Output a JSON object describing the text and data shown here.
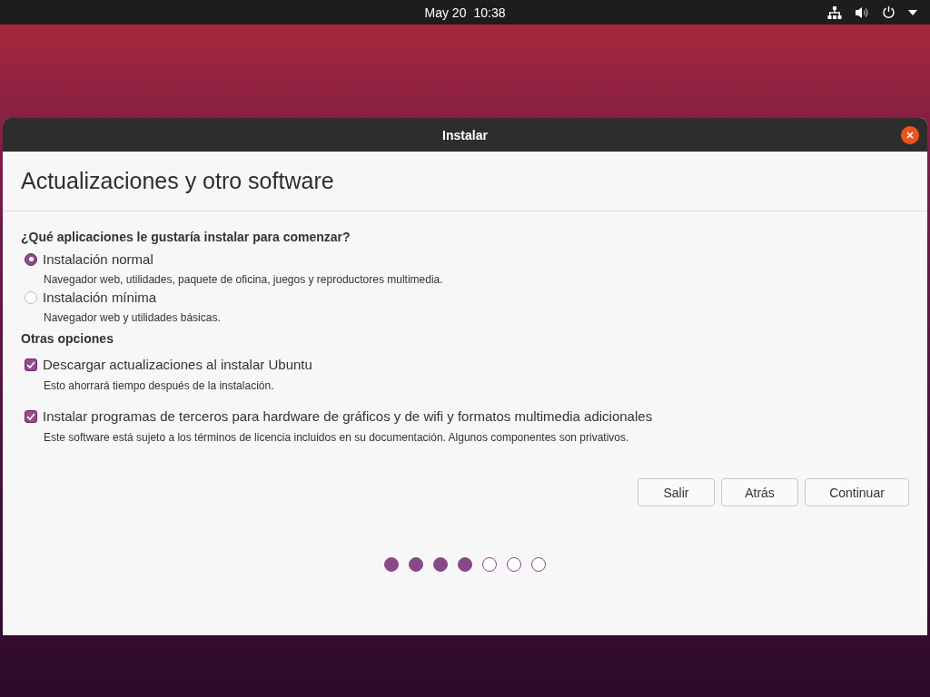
{
  "top_bar": {
    "date": "May 20",
    "time": "10:38"
  },
  "window": {
    "title": "Instalar"
  },
  "page_title": "Actualizaciones y otro software",
  "question": "¿Qué aplicaciones le gustaría instalar para comenzar?",
  "install_types": [
    {
      "label": "Instalación normal",
      "description": "Navegador web, utilidades, paquete de oficina, juegos y reproductores multimedia.",
      "selected": true
    },
    {
      "label": "Instalación mínima",
      "description": "Navegador web y utilidades básicas.",
      "selected": false
    }
  ],
  "other_heading": "Otras opciones",
  "options": [
    {
      "label": "Descargar actualizaciones al instalar Ubuntu",
      "description": "Esto ahorrará tiempo después de la instalación.",
      "checked": true
    },
    {
      "label": "Instalar programas de terceros para hardware de gráficos y de wifi y formatos multimedia adicionales",
      "description": "Este software está sujeto a los términos de licencia incluidos en su documentación. Algunos componentes son privativos.",
      "checked": true
    }
  ],
  "buttons": [
    "Salir",
    "Atrás",
    "Continuar"
  ],
  "progress": [
    {
      "filled": true
    },
    {
      "filled": true
    },
    {
      "filled": true
    },
    {
      "filled": true
    },
    {
      "filled": false
    },
    {
      "filled": false
    },
    {
      "filled": false
    }
  ]
}
